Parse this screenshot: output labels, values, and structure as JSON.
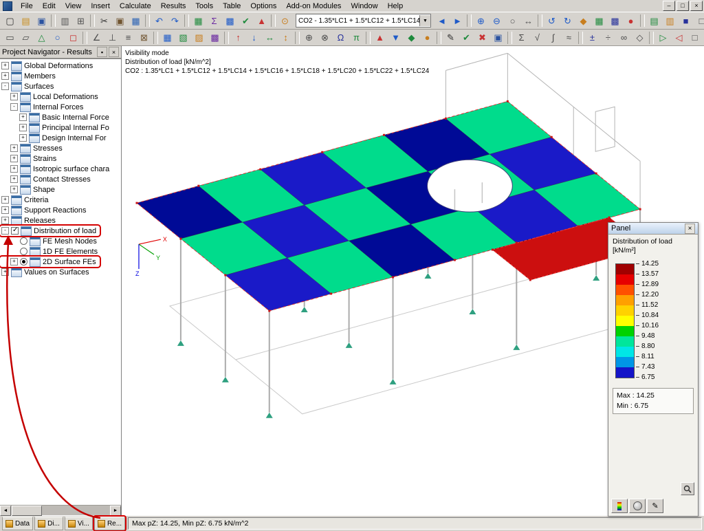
{
  "window": {
    "controls": [
      "–",
      "□",
      "×"
    ]
  },
  "menu": {
    "items": [
      "File",
      "Edit",
      "View",
      "Insert",
      "Calculate",
      "Results",
      "Tools",
      "Table",
      "Options",
      "Add-on Modules",
      "Window",
      "Help"
    ]
  },
  "toolbar1": {
    "load_case": "CO2 - 1.35*LC1 + 1.5*LC12 + 1.5*LC14",
    "left": [
      {
        "g": "▢",
        "c": "#303030"
      },
      {
        "g": "▤",
        "c": "#C88E1E"
      },
      {
        "g": "▣",
        "c": "#2A52A0"
      },
      {
        "t": "s"
      },
      {
        "g": "▥",
        "c": "#555555"
      },
      {
        "g": "⊞",
        "c": "#555555"
      },
      {
        "t": "s"
      },
      {
        "g": "✂",
        "c": "#303030"
      },
      {
        "g": "▣",
        "c": "#705430"
      },
      {
        "g": "▦",
        "c": "#2A62B4"
      },
      {
        "t": "s"
      },
      {
        "g": "↶",
        "c": "#1E5AC8"
      },
      {
        "g": "↷",
        "c": "#1E5AC8"
      },
      {
        "t": "s"
      },
      {
        "g": "▦",
        "c": "#1E8A3C"
      },
      {
        "g": "Σ",
        "c": "#6A28A0"
      },
      {
        "g": "▩",
        "c": "#1E5AC8"
      },
      {
        "g": "✔",
        "c": "#1E8A3C"
      },
      {
        "g": "▲",
        "c": "#C83232"
      },
      {
        "t": "s"
      },
      {
        "g": "⊙",
        "c": "#C87E1E"
      }
    ],
    "right": [
      {
        "g": "◄",
        "c": "#1E5AC8"
      },
      {
        "g": "►",
        "c": "#1E5AC8"
      },
      {
        "t": "s"
      },
      {
        "g": "⊕",
        "c": "#1E5AC8"
      },
      {
        "g": "⊖",
        "c": "#1E5AC8"
      },
      {
        "g": "○",
        "c": "#555555"
      },
      {
        "g": "↔",
        "c": "#555555"
      },
      {
        "t": "s"
      },
      {
        "g": "↺",
        "c": "#1E5AC8"
      },
      {
        "g": "↻",
        "c": "#1E5AC8"
      },
      {
        "g": "◆",
        "c": "#C87E1E"
      },
      {
        "g": "▦",
        "c": "#1E8A3C"
      },
      {
        "g": "▩",
        "c": "#28329B"
      },
      {
        "g": "●",
        "c": "#C83232"
      },
      {
        "t": "s"
      },
      {
        "g": "▤",
        "c": "#1E8A3C"
      },
      {
        "g": "▥",
        "c": "#C87E1E"
      },
      {
        "g": "■",
        "c": "#28329B"
      },
      {
        "g": "□",
        "c": "#4A4A4A"
      },
      {
        "g": "◎",
        "c": "#C83232"
      },
      {
        "g": "▧",
        "c": "#555555"
      },
      {
        "g": "▨",
        "c": "#966432"
      }
    ]
  },
  "toolbar2": {
    "icons": [
      {
        "g": "▭",
        "c": "#4A4A4A"
      },
      {
        "g": "▱",
        "c": "#4A4A4A"
      },
      {
        "g": "△",
        "c": "#1E8A3C"
      },
      {
        "g": "○",
        "c": "#1E5AC8"
      },
      {
        "g": "◻",
        "c": "#C83232"
      },
      {
        "t": "s"
      },
      {
        "g": "∠",
        "c": "#4A4A4A"
      },
      {
        "g": "⊥",
        "c": "#4A4A4A"
      },
      {
        "g": "≡",
        "c": "#4A4A4A"
      },
      {
        "g": "⊠",
        "c": "#705430"
      },
      {
        "t": "s"
      },
      {
        "g": "▦",
        "c": "#1E5AC8"
      },
      {
        "g": "▧",
        "c": "#1E8A3C"
      },
      {
        "g": "▨",
        "c": "#C87E1E"
      },
      {
        "g": "▩",
        "c": "#6A28A0"
      },
      {
        "t": "s"
      },
      {
        "g": "↑",
        "c": "#C83232"
      },
      {
        "g": "↓",
        "c": "#1E5AC8"
      },
      {
        "g": "↔",
        "c": "#1E8A3C"
      },
      {
        "g": "↕",
        "c": "#C87E1E"
      },
      {
        "t": "s"
      },
      {
        "g": "⊕",
        "c": "#4A4A4A"
      },
      {
        "g": "⊗",
        "c": "#4A4A4A"
      },
      {
        "g": "Ω",
        "c": "#28329B"
      },
      {
        "g": "π",
        "c": "#1E8A3C"
      },
      {
        "t": "s"
      },
      {
        "g": "▲",
        "c": "#C83232"
      },
      {
        "g": "▼",
        "c": "#1E5AC8"
      },
      {
        "g": "◆",
        "c": "#1E8A3C"
      },
      {
        "g": "●",
        "c": "#C87E1E"
      },
      {
        "t": "s"
      },
      {
        "g": "✎",
        "c": "#303030"
      },
      {
        "g": "✔",
        "c": "#1E8A3C"
      },
      {
        "g": "✖",
        "c": "#C83232"
      },
      {
        "g": "▣",
        "c": "#2A52A0"
      },
      {
        "t": "s"
      },
      {
        "g": "Σ",
        "c": "#4A4A4A"
      },
      {
        "g": "√",
        "c": "#4A4A4A"
      },
      {
        "g": "∫",
        "c": "#4A4A4A"
      },
      {
        "g": "≈",
        "c": "#4A4A4A"
      },
      {
        "t": "s"
      },
      {
        "g": "±",
        "c": "#28329B"
      },
      {
        "g": "÷",
        "c": "#4A4A4A"
      },
      {
        "g": "∞",
        "c": "#4A4A4A"
      },
      {
        "g": "◇",
        "c": "#4A4A4A"
      },
      {
        "t": "s"
      },
      {
        "g": "▷",
        "c": "#1E8A3C"
      },
      {
        "g": "◁",
        "c": "#C83232"
      },
      {
        "g": "□",
        "c": "#4A4A4A"
      },
      {
        "g": "■",
        "c": "#28329B"
      },
      {
        "g": "⊟",
        "c": "#4A4A4A"
      },
      {
        "g": "★",
        "c": "#C87E1E"
      }
    ]
  },
  "navigator": {
    "title": "Project Navigator - Results",
    "scroll_left": "◄",
    "scroll_right": "►",
    "tree": [
      {
        "label": "Global Deformations",
        "lvl": 0,
        "exp": "+"
      },
      {
        "label": "Members",
        "lvl": 0,
        "exp": "+"
      },
      {
        "label": "Surfaces",
        "lvl": 0,
        "exp": "-"
      },
      {
        "label": "Local Deformations",
        "lvl": 1,
        "exp": "+"
      },
      {
        "label": "Internal Forces",
        "lvl": 1,
        "exp": "-"
      },
      {
        "label": "Basic Internal Force",
        "lvl": 2,
        "exp": "+"
      },
      {
        "label": "Principal Internal Fo",
        "lvl": 2,
        "exp": "+"
      },
      {
        "label": "Design Internal For",
        "lvl": 2,
        "exp": "+"
      },
      {
        "label": "Stresses",
        "lvl": 1,
        "exp": "+"
      },
      {
        "label": "Strains",
        "lvl": 1,
        "exp": "+"
      },
      {
        "label": "Isotropic surface chara",
        "lvl": 1,
        "exp": "+"
      },
      {
        "label": "Contact Stresses",
        "lvl": 1,
        "exp": "+"
      },
      {
        "label": "Shape",
        "lvl": 1,
        "exp": "+"
      },
      {
        "label": "Criteria",
        "lvl": 0,
        "exp": "+"
      },
      {
        "label": "Support Reactions",
        "lvl": 0,
        "exp": "+"
      },
      {
        "label": "Releases",
        "lvl": 0,
        "exp": "+"
      },
      {
        "label": "Distribution of load",
        "lvl": 0,
        "exp": "-",
        "ctrl": "cb",
        "hl": true
      },
      {
        "label": "FE Mesh Nodes",
        "lvl": 1,
        "ctrl": "roff"
      },
      {
        "label": "1D FE Elements",
        "lvl": 1,
        "ctrl": "roff"
      },
      {
        "label": "2D Surface FEs",
        "lvl": 1,
        "exp": "+",
        "ctrl": "ron",
        "hl": true
      },
      {
        "label": "Values on Surfaces",
        "lvl": 0,
        "exp": "+"
      }
    ],
    "tabs": [
      {
        "label": "Data"
      },
      {
        "label": "Di..."
      },
      {
        "label": "Vi..."
      },
      {
        "label": "Re...",
        "hl": true
      }
    ]
  },
  "viewport": {
    "overlay_lines": [
      "Visibility mode",
      "Distribution of load [kN/m^2]",
      "CO2 : 1.35*LC1 + 1.5*LC12 + 1.5*LC14 + 1.5*LC16 + 1.5*LC18 + 1.5*LC20 + 1.5*LC22 + 1.5*LC24"
    ]
  },
  "panel": {
    "title": "Panel",
    "subtitle1": "Distribution of load",
    "subtitle2": "[kN/m²]",
    "scale_colors": [
      "#A00000",
      "#E60000",
      "#FF5000",
      "#FFA000",
      "#FFD200",
      "#FFFF00",
      "#00D200",
      "#00E69B",
      "#00E6E6",
      "#0096E6",
      "#1414C8"
    ],
    "scale_values": [
      "14.25",
      "13.57",
      "12.89",
      "12.20",
      "11.52",
      "10.84",
      "10.16",
      "9.48",
      "8.80",
      "8.11",
      "7.43",
      "6.75"
    ],
    "max_label": "Max :",
    "max_value": "14.25",
    "min_label": "Min :",
    "min_value": "6.75"
  },
  "statusbar": {
    "text": "Max pZ: 14.25, Min pZ: 6.75 kN/m^2"
  }
}
